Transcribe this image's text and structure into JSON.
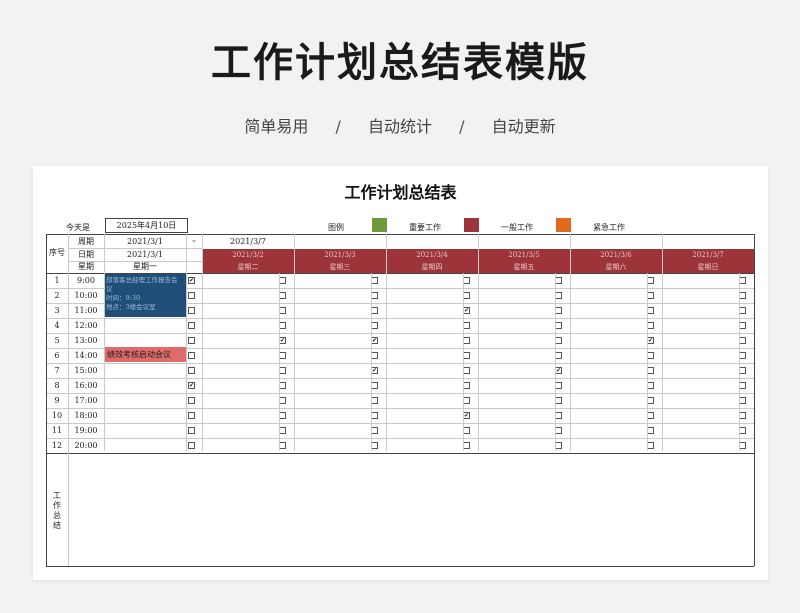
{
  "hero": {
    "title": "工作计划总结表模版",
    "tags": [
      "简单易用",
      "自动统计",
      "自动更新"
    ],
    "separator": "/"
  },
  "sheet": {
    "title": "工作计划总结表",
    "today_label": "今天是",
    "today_value": "2025年4月10日",
    "legend_label": "图例",
    "legend": [
      {
        "label": "重要工作",
        "color": "#6f9a3c"
      },
      {
        "label": "一般工作",
        "color": "#9c3439"
      },
      {
        "label": "紧急工作",
        "color": "#e06a1b"
      }
    ],
    "seq_header": "序号",
    "week_label": "周期",
    "date_label": "日期",
    "weekday_label": "星期",
    "week_start": "2021/3/1",
    "week_end": "2021/3/7",
    "dropdown_glyph": "⌄",
    "day1": {
      "date": "2021/3/1",
      "weekday": "星期一"
    },
    "days": [
      {
        "date": "2021/3/2",
        "weekday": "星期二"
      },
      {
        "date": "2021/3/3",
        "weekday": "星期三"
      },
      {
        "date": "2021/3/4",
        "weekday": "星期四"
      },
      {
        "date": "2021/3/5",
        "weekday": "星期五"
      },
      {
        "date": "2021/3/6",
        "weekday": "星期六"
      },
      {
        "date": "2021/3/7",
        "weekday": "星期日"
      }
    ],
    "rows": [
      {
        "seq": "1",
        "time": "9:00"
      },
      {
        "seq": "2",
        "time": "10:00"
      },
      {
        "seq": "3",
        "time": "11:00"
      },
      {
        "seq": "4",
        "time": "12:00"
      },
      {
        "seq": "5",
        "time": "13:00"
      },
      {
        "seq": "6",
        "time": "14:00"
      },
      {
        "seq": "7",
        "time": "15:00"
      },
      {
        "seq": "8",
        "time": "16:00"
      },
      {
        "seq": "9",
        "time": "17:00"
      },
      {
        "seq": "10",
        "time": "18:00"
      },
      {
        "seq": "11",
        "time": "19:00"
      },
      {
        "seq": "12",
        "time": "20:00"
      }
    ],
    "checks": [
      [
        true,
        false,
        false,
        false,
        false,
        false,
        false
      ],
      [
        false,
        false,
        false,
        false,
        false,
        false,
        false
      ],
      [
        false,
        false,
        false,
        true,
        false,
        false,
        false
      ],
      [
        false,
        false,
        false,
        false,
        false,
        false,
        false
      ],
      [
        false,
        true,
        true,
        false,
        false,
        true,
        false
      ],
      [
        false,
        false,
        false,
        false,
        false,
        false,
        false
      ],
      [
        false,
        false,
        true,
        false,
        true,
        false,
        false
      ],
      [
        true,
        false,
        false,
        false,
        false,
        false,
        false
      ],
      [
        false,
        false,
        false,
        false,
        false,
        false,
        false
      ],
      [
        false,
        false,
        false,
        true,
        false,
        false,
        false
      ],
      [
        false,
        false,
        false,
        false,
        false,
        false,
        false
      ],
      [
        false,
        false,
        false,
        false,
        false,
        false,
        false
      ]
    ],
    "check_mark": "✔",
    "task1": {
      "lines": [
        "部落客总经理工作报告会",
        "议",
        "时间：9:30",
        "地点：3楼会议室"
      ],
      "color": "#1f4e79"
    },
    "task2": {
      "text": "绩效考核启动会议",
      "color": "#e06b6b"
    },
    "summary_label": "工作总结",
    "summary_chars": [
      "工",
      "作",
      "总",
      "结"
    ]
  }
}
